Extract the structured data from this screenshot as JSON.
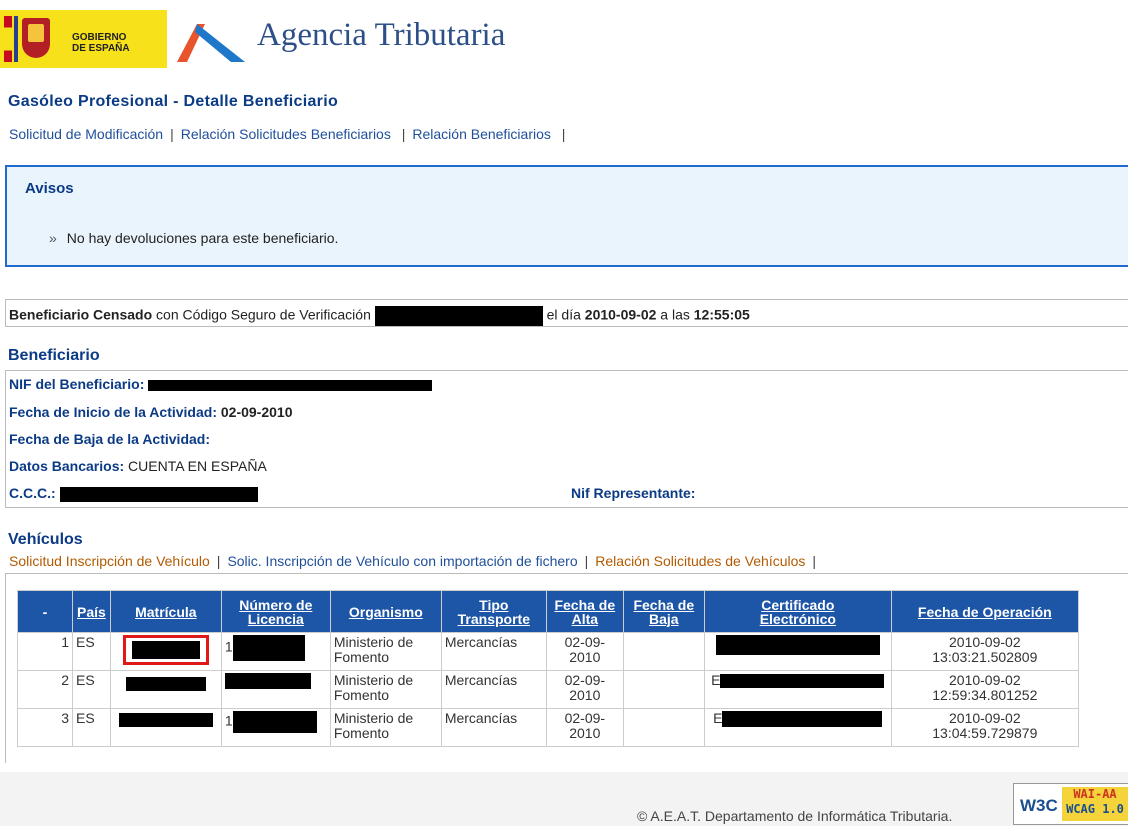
{
  "header": {
    "gov_line1": "GOBIERNO",
    "gov_line2": "DE ESPAÑA",
    "agency_name": "Agencia Tributaria"
  },
  "page_title": "Gasóleo Profesional - Detalle Beneficiario",
  "top_links": [
    "Solicitud de Modificación",
    "Relación Solicitudes Beneficiarios",
    "Relación Beneficiarios"
  ],
  "avisos": {
    "title": "Avisos",
    "message": "No hay devoluciones para este beneficiario."
  },
  "status": {
    "state": "Beneficiario Censado",
    "text1": "con Código Seguro de Verificación",
    "text2": "el día",
    "date": "2010-09-02",
    "text3": "a las",
    "time": "12:55:05"
  },
  "beneficiario": {
    "title": "Beneficiario",
    "nif_label": "NIF del Beneficiario:",
    "inicio_label": "Fecha de Inicio de la Actividad:",
    "inicio_value": "02-09-2010",
    "baja_label": "Fecha de Baja de la Actividad:",
    "bancarios_label": "Datos Bancarios:",
    "bancarios_value": "CUENTA EN ESPAÑA",
    "ccc_label": "C.C.C.:",
    "representante_label": "Nif Representante:"
  },
  "vehiculos": {
    "title": "Vehículos",
    "links": [
      "Solicitud Inscripción de Vehículo",
      "Solic. Inscripción de Vehículo con importación de fichero",
      "Relación Solicitudes de Vehículos"
    ],
    "columns": {
      "index": "-",
      "pais": "País",
      "matricula": "Matrícula",
      "licencia_1": "Número de",
      "licencia_2": "Licencia",
      "organismo": "Organismo",
      "tipo_1": "Tipo",
      "tipo_2": "Transporte",
      "alta_1": "Fecha de",
      "alta_2": "Alta",
      "baja_1": "Fecha de",
      "baja_2": "Baja",
      "cert_1": "Certificado",
      "cert_2": "Electrónico",
      "operacion": "Fecha de Operación"
    },
    "rows": [
      {
        "index": "1",
        "pais": "ES",
        "licencia_prefix": "1",
        "org_1": "Ministerio de",
        "org_2": "Fomento",
        "tipo": "Mercancías",
        "alta_1": "02-09-",
        "alta_2": "2010",
        "cert_prefix": "",
        "op_1": "2010-09-02",
        "op_2": "13:03:21.502809"
      },
      {
        "index": "2",
        "pais": "ES",
        "licencia_prefix": "",
        "org_1": "Ministerio de",
        "org_2": "Fomento",
        "tipo": "Mercancías",
        "alta_1": "02-09-",
        "alta_2": "2010",
        "cert_prefix": "E",
        "op_1": "2010-09-02",
        "op_2": "12:59:34.801252"
      },
      {
        "index": "3",
        "pais": "ES",
        "licencia_prefix": "1",
        "org_1": "Ministerio de",
        "org_2": "Fomento",
        "tipo": "Mercancías",
        "alta_1": "02-09-",
        "alta_2": "2010",
        "cert_prefix": "E",
        "op_1": "2010-09-02",
        "op_2": "13:04:59.729879"
      }
    ]
  },
  "footer": {
    "copyright": "© A.E.A.T. Departamento de Informática Tributaria.",
    "badge_w3c": "W3C",
    "badge_wai": "WAI-AA",
    "badge_wcag": "WCAG 1.0"
  }
}
